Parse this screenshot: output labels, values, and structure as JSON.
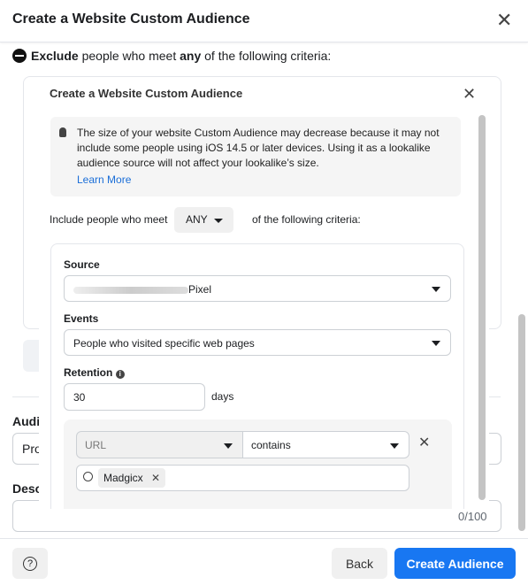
{
  "modal": {
    "title": "Create a Website Custom Audience"
  },
  "exclude": {
    "bold1": "Exclude",
    "text1": " people who meet ",
    "bold2": "any",
    "text2": " of the following criteria:"
  },
  "background": {
    "audience_label": "Audi",
    "audience_value": "Pro",
    "description_label": "Desc",
    "char_count": "0/100"
  },
  "inner": {
    "title": "Create a Website Custom Audience",
    "info": "The size of your website Custom Audience may decrease because it may not include some people using iOS 14.5 or later devices. Using it as a lookalike audience source will not affect your lookalike’s size.",
    "learn_more": "Learn More",
    "include_prefix": "Include people who meet",
    "include_value": "ANY",
    "include_suffix": "of the following criteria:",
    "source_label": "Source",
    "source_value": "Pixel",
    "events_label": "Events",
    "events_value": "People who visited specific web pages",
    "retention_label": "Retention",
    "retention_value": "30",
    "retention_unit": "days",
    "rule_field": "URL",
    "rule_operator": "contains",
    "rule_tag": "Madgicx"
  },
  "footer": {
    "back": "Back",
    "create": "Create Audience"
  },
  "colors": {
    "primary": "#1877f2",
    "link": "#1a6ed8"
  }
}
